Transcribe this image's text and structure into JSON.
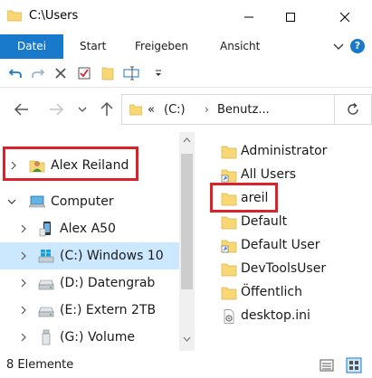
{
  "window": {
    "title": "C:\\Users"
  },
  "ribbon": {
    "tabs": [
      {
        "label": "Datei"
      },
      {
        "label": "Start"
      },
      {
        "label": "Freigeben"
      },
      {
        "label": "Ansicht"
      }
    ],
    "help_label": "?"
  },
  "address": {
    "prefix": "«",
    "segments": [
      "(C:)",
      "Benutz..."
    ]
  },
  "tree": [
    {
      "label": "Alex Reiland",
      "icon": "user-folder-icon",
      "expanded": false
    },
    {
      "label": "Computer",
      "icon": "computer-icon",
      "expanded": true
    },
    {
      "label": "Alex A50",
      "icon": "phone-icon",
      "expanded": false
    },
    {
      "label": "(C:) Windows 10",
      "icon": "windows-drive-icon",
      "expanded": false,
      "selected": true
    },
    {
      "label": "(D:) Datengrab",
      "icon": "drive-icon",
      "expanded": false
    },
    {
      "label": "(E:) Extern 2TB",
      "icon": "drive-icon",
      "expanded": false
    },
    {
      "label": "(G:) Volume",
      "icon": "usb-drive-icon",
      "expanded": false
    }
  ],
  "files": [
    {
      "label": "Administrator",
      "icon": "folder-icon"
    },
    {
      "label": "All Users",
      "icon": "folder-shortcut-icon"
    },
    {
      "label": "areil",
      "icon": "folder-icon"
    },
    {
      "label": "Default",
      "icon": "folder-icon"
    },
    {
      "label": "Default User",
      "icon": "folder-shortcut-icon"
    },
    {
      "label": "DevToolsUser",
      "icon": "folder-icon"
    },
    {
      "label": "Öffentlich",
      "icon": "folder-icon"
    },
    {
      "label": "desktop.ini",
      "icon": "settings-file-icon"
    }
  ],
  "status": {
    "item_count": "8 Elemente"
  },
  "colors": {
    "accent": "#1979ca",
    "selection": "#cce8ff",
    "highlight_box": "#d9232a",
    "folder": "#f8d775"
  }
}
